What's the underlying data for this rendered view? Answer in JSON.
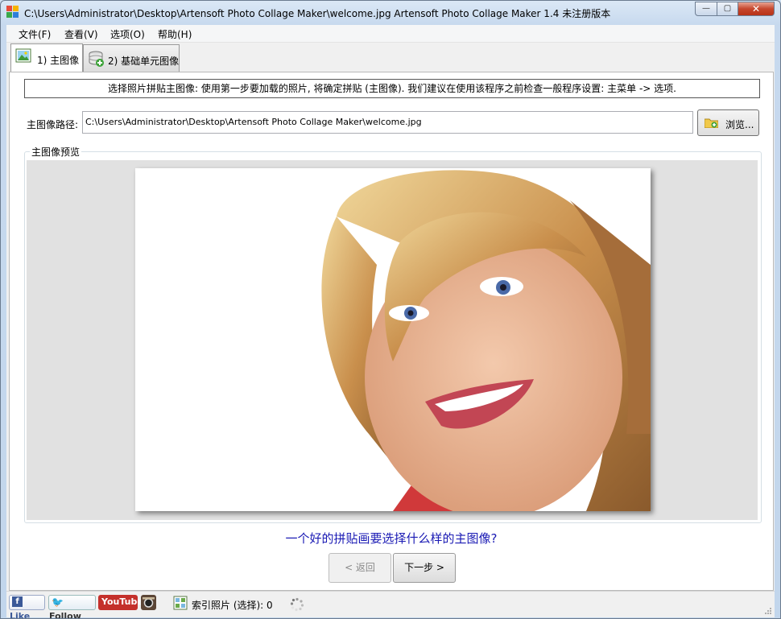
{
  "window": {
    "title": "C:\\Users\\Administrator\\Desktop\\Artensoft Photo Collage Maker\\welcome.jpg Artensoft Photo Collage Maker 1.4  未注册版本",
    "controls": {
      "minimize": "—",
      "maximize": "▢",
      "close": "✕"
    }
  },
  "menu": [
    {
      "label": "文件(F)"
    },
    {
      "label": "查看(V)"
    },
    {
      "label": "选项(O)"
    },
    {
      "label": "帮助(H)"
    }
  ],
  "tabs": [
    {
      "label": "1) 主图像",
      "icon": "main-image-icon",
      "active": true
    },
    {
      "label": "2) 基础单元图像",
      "icon": "add-database-icon",
      "active": false
    }
  ],
  "main": {
    "info": "选择照片拼贴主图像: 使用第一步要加载的照片, 将确定拼贴 (主图像). 我们建议在使用该程序之前检查一般程序设置: 主菜单 -> 选项.",
    "path_label": "主图像路径:",
    "path_value": "C:\\Users\\Administrator\\Desktop\\Artensoft Photo Collage Maker\\welcome.jpg",
    "browse_label": "浏览...",
    "preview_title": "主图像预览",
    "question": "一个好的拼贴画要选择什么样的主图像?",
    "back_label": "< 返回",
    "next_label": "下一步 >"
  },
  "status": {
    "facebook_label": "Like",
    "twitter_label": "Follow",
    "youtube_label": "YouTube",
    "index_text": "索引照片 (选择): 0"
  },
  "colors": {
    "accent_blue": "#1a1ab4",
    "facebook": "#3b5998",
    "youtube": "#c4302b"
  }
}
